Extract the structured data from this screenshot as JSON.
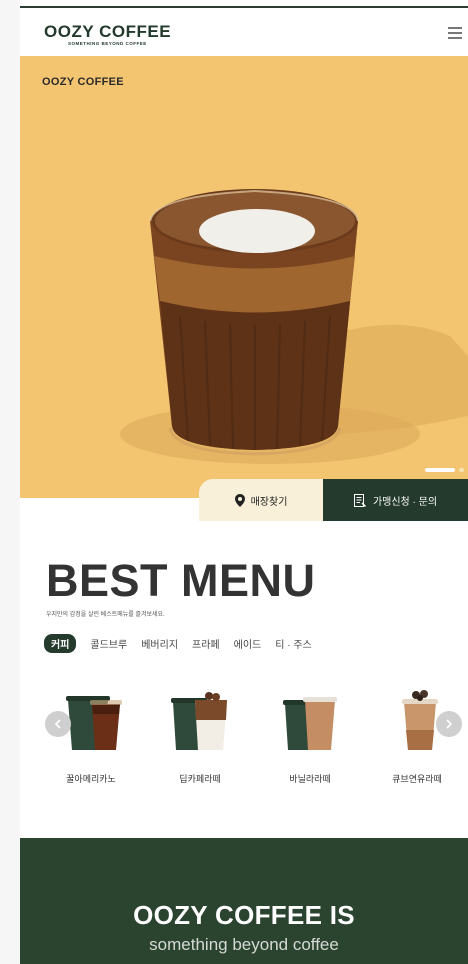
{
  "header": {
    "logo": "OOZY COFFEE",
    "logo_tagline": "SOMETHING BEYOND COFFEE",
    "menu_icon": "hamburger-menu-icon"
  },
  "hero": {
    "brand": "OOZY COFFEE",
    "background_color": "#f3c571",
    "slide_indicator": {
      "current": 1,
      "total": 2
    }
  },
  "actions": {
    "store_finder": {
      "label": "매장찾기",
      "icon": "location-pin-icon"
    },
    "franchise": {
      "label": "가맹신청 · 문의",
      "icon": "document-icon"
    }
  },
  "best_menu": {
    "title": "BEST MENU",
    "description": "우지만의 감정을 살린 베스트메뉴를 즐겨보세요.",
    "tabs": [
      {
        "label": "커피",
        "active": true
      },
      {
        "label": "콜드브루",
        "active": false
      },
      {
        "label": "베버리지",
        "active": false
      },
      {
        "label": "프라페",
        "active": false
      },
      {
        "label": "에이드",
        "active": false
      },
      {
        "label": "티 · 주스",
        "active": false
      }
    ],
    "products": [
      {
        "name": "꿀아메리카노"
      },
      {
        "name": "딥카페라떼"
      },
      {
        "name": "바닐라라떼"
      },
      {
        "name": "큐브연유라떼"
      }
    ]
  },
  "about": {
    "title": "OOZY COFFEE IS",
    "subtitle": "something beyond coffee"
  },
  "colors": {
    "brand_green": "#233a2c",
    "hero_yellow": "#f3c571",
    "cream": "#f8f0d9"
  }
}
